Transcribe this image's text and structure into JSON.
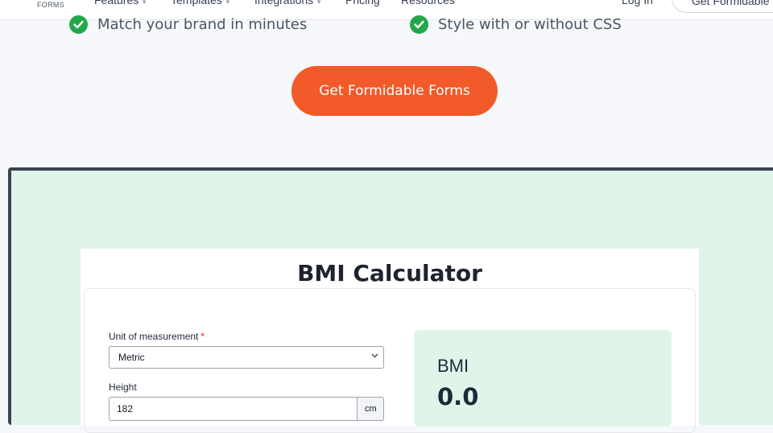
{
  "nav": {
    "logo_text": "FORMS",
    "items": [
      {
        "label": "Features",
        "has_caret": true
      },
      {
        "label": "Templates",
        "has_caret": true
      },
      {
        "label": "Integrations",
        "has_caret": true
      },
      {
        "label": "Pricing",
        "has_caret": false
      },
      {
        "label": "Resources",
        "has_caret": false
      }
    ],
    "login": "Log In",
    "cta": "Get Formidable"
  },
  "features": [
    {
      "text": "Match your brand in minutes"
    },
    {
      "text": "Style with or without CSS"
    }
  ],
  "main_cta": "Get Formidable Forms",
  "calculator": {
    "title": "BMI Calculator",
    "unit_label": "Unit of measurement",
    "required_mark": "*",
    "unit_value": "Metric",
    "height_label": "Height",
    "height_value": "182",
    "height_unit": "cm",
    "result_label": "BMI",
    "result_value": "0.0"
  },
  "colors": {
    "accent": "#f25a29",
    "check": "#22a84a",
    "demo_bg": "#e0f5ea"
  }
}
